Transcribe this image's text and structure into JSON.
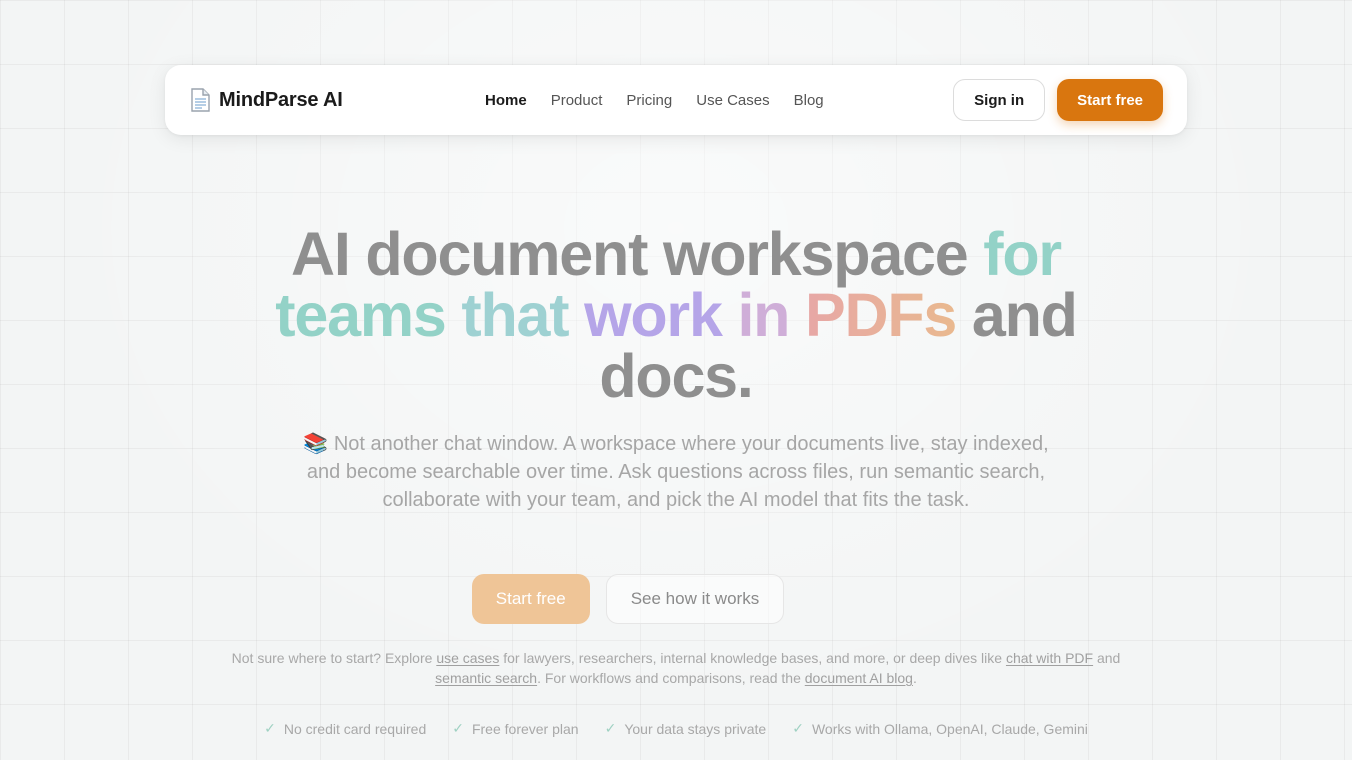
{
  "nav": {
    "brand_icon": "page-facing-up-icon",
    "brand_name": "MindParse AI",
    "links": [
      "Home",
      "Product",
      "Pricing",
      "Use Cases",
      "Blog"
    ],
    "signin_label": "Sign in",
    "start_label": "Start free"
  },
  "hero": {
    "title_parts": [
      "AI document workspace",
      "for",
      "teams",
      "that",
      "work",
      "in",
      "PDFs",
      "and",
      "docs."
    ],
    "subtitle_icon": "📚",
    "subtitle": "Not another chat window. A workspace where your documents live, stay indexed, and become searchable over time. Ask questions across files, run semantic search, collaborate with your team, and pick the AI model that fits the task.",
    "cta_primary": "Start free",
    "cta_secondary": "See how it works"
  },
  "explore": {
    "t1": "Not sure where to start? Explore ",
    "l1": "use cases",
    "t2": " for lawyers, researchers, internal knowledge bases, and more, or deep dives like ",
    "l2": "chat with PDF",
    "t3": " and ",
    "l3": "semantic search",
    "t4": ". For workflows and comparisons, read the ",
    "l4": "document AI blog",
    "t5": "."
  },
  "features": [
    "No credit card required",
    "Free forever plan",
    "Your data stays private",
    "Works with Ollama, OpenAI, Claude, Gemini"
  ],
  "colors": {
    "accent": "#d9760f",
    "accent_faded": "#efc597",
    "gradient_teal": "#93d2c7",
    "gradient_purple": "#b5a5e8",
    "gradient_peach": "#e9b98f"
  }
}
